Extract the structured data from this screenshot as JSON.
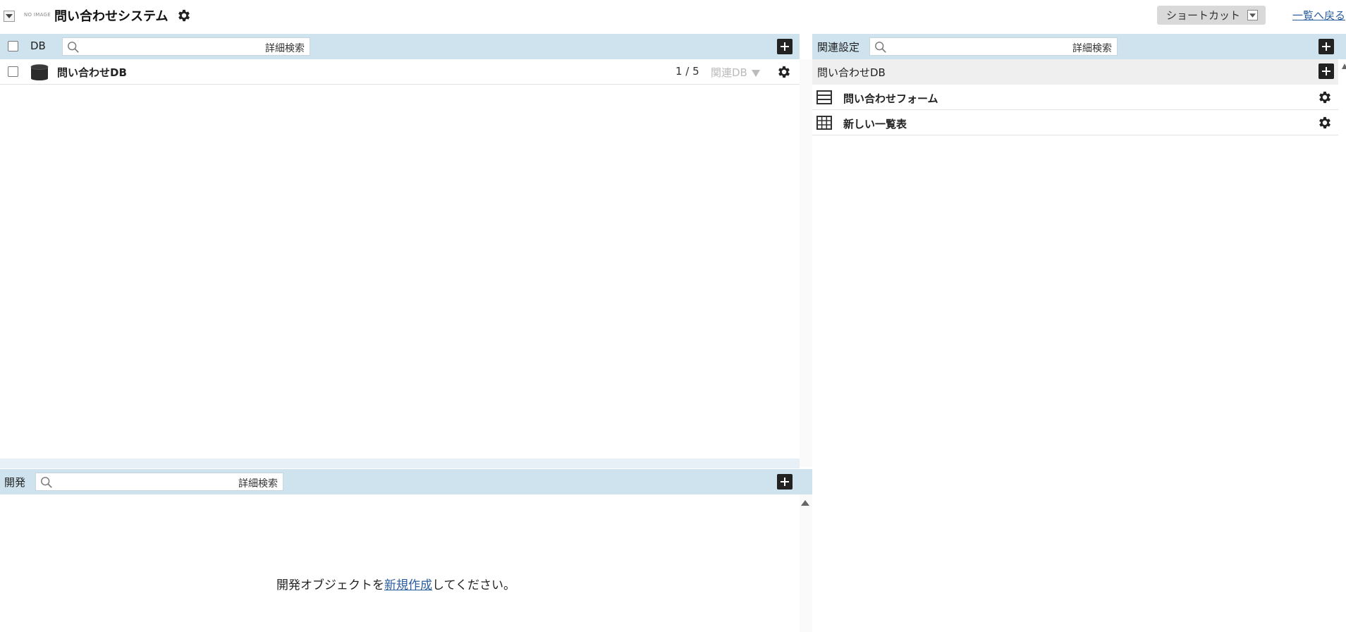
{
  "header": {
    "no_image": "NO IMAGE",
    "title": "問い合わせシステム",
    "shortcut_label": "ショートカット",
    "back_link": "一覧へ戻る"
  },
  "db_panel": {
    "header_label": "DB",
    "search_adv": "詳細検索",
    "rows": [
      {
        "name": "問い合わせDB",
        "count": "1 / 5",
        "related": "関連DB"
      }
    ]
  },
  "dev_panel": {
    "header_label": "開発",
    "search_adv": "詳細検索",
    "empty_prefix": "開発オブジェクトを",
    "empty_link": "新規作成",
    "empty_suffix": "してください。"
  },
  "related_panel": {
    "header_label": "関連設定",
    "search_adv": "詳細検索",
    "group_label": "問い合わせDB",
    "items": [
      {
        "name": "問い合わせフォーム",
        "icon": "form-icon"
      },
      {
        "name": "新しい一覧表",
        "icon": "table-icon"
      }
    ]
  },
  "colors": {
    "header_bar": "#cfe3ee",
    "link": "#2a5d9f",
    "group_bg": "#efefef"
  }
}
